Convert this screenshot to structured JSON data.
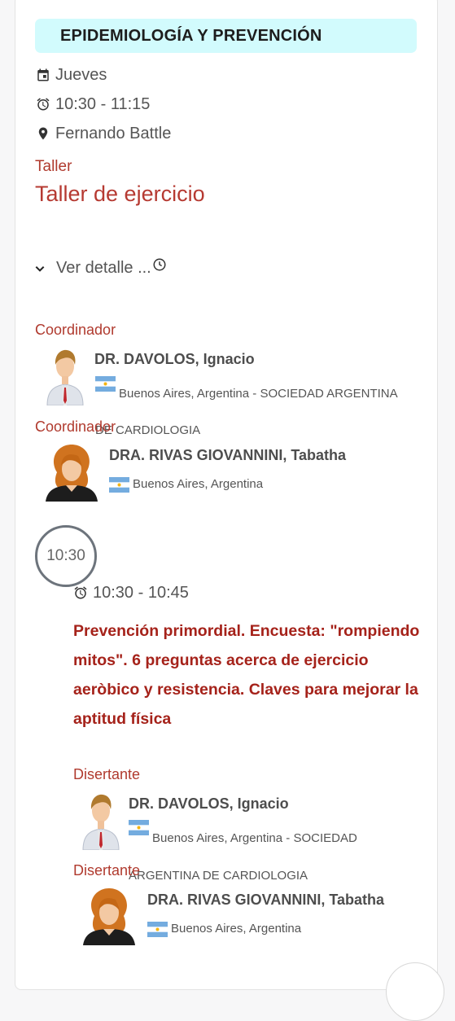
{
  "section": {
    "title": "EPIDEMIOLOGÍA Y PREVENCIÓN"
  },
  "session": {
    "day": "Jueves",
    "time": "10:30 - 11:15",
    "location": "Fernando Battle",
    "type": "Taller",
    "title": "Taller de ejercicio",
    "details_toggle": "Ver detalle ..."
  },
  "coordinators": [
    {
      "role": "Coordinador",
      "name": "DR. DAVOLOS, Ignacio",
      "affiliation_line1": "Buenos Aires, Argentina - SOCIEDAD ARGENTINA",
      "affiliation_line2": "DE CARDIOLOGIA"
    },
    {
      "role": "Coordinador",
      "name": "DRA. RIVAS GIOVANNINI, Tabatha",
      "affiliation_line1": "Buenos Aires, Argentina"
    }
  ],
  "talk": {
    "time_badge": "10:30",
    "time_range": "10:30 - 10:45",
    "title": "Prevención primordial. Encuesta: \"rompiendo mitos\". 6 preguntas acerca de ejercicio aeròbico y resistencia. Claves para mejorar la aptitud física",
    "speakers": [
      {
        "role": "Disertante",
        "name": "DR. DAVOLOS, Ignacio",
        "affiliation_line1": "Buenos Aires, Argentina - SOCIEDAD",
        "affiliation_line2": "ARGENTINA DE CARDIOLOGIA"
      },
      {
        "role": "Disertante",
        "name": "DRA. RIVAS GIOVANNINI, Tabatha",
        "affiliation_line1": "Buenos Aires, Argentina"
      }
    ]
  },
  "colors": {
    "header_bg": "#d2fbfd",
    "accent_red": "#b03a2e",
    "title_red": "#a5221a",
    "text_gray": "#555555"
  },
  "icons": {
    "day": "calendar-icon",
    "time": "alarm-clock-icon",
    "location": "location-pin-icon",
    "toggle": "chevron-down-icon",
    "details_extra": "clock-icon",
    "flag": "argentina-flag-icon",
    "male_avatar": "male-avatar-icon",
    "female_avatar": "female-avatar-icon"
  }
}
